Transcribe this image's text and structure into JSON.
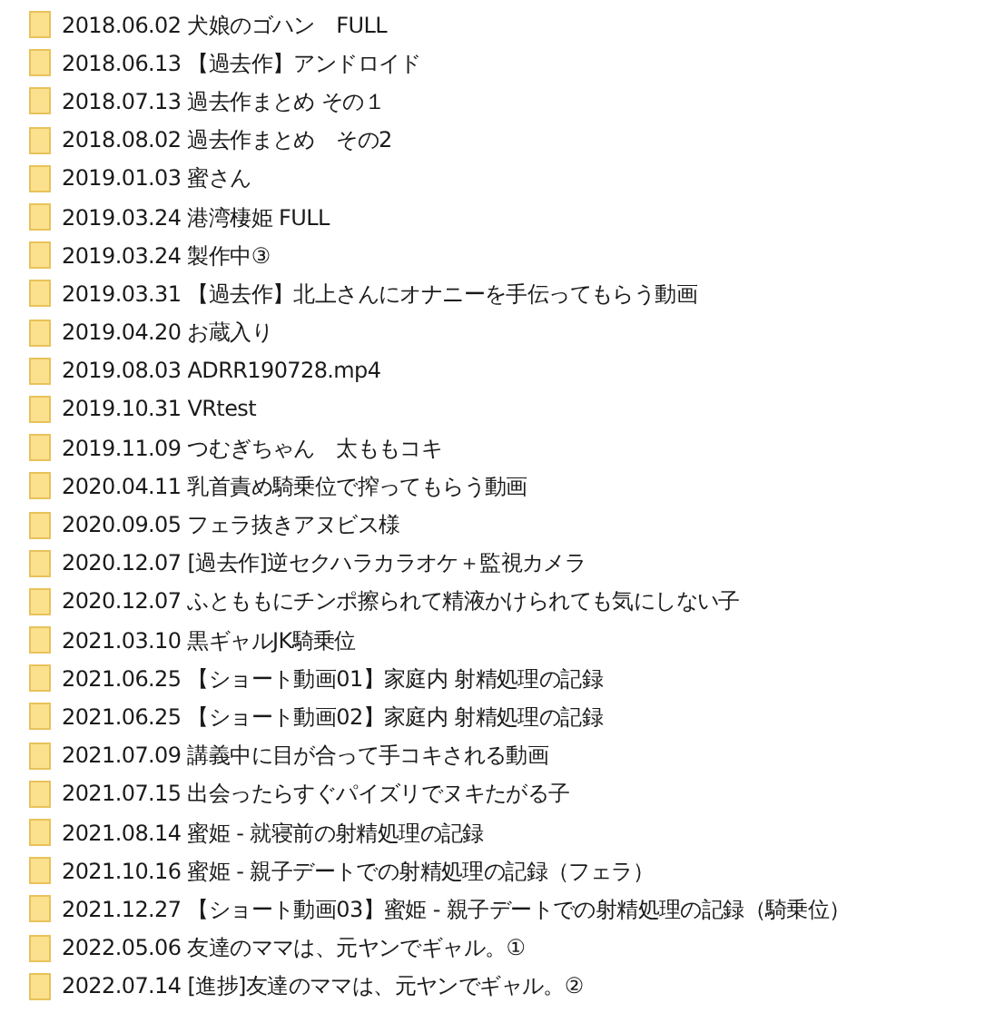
{
  "files": [
    {
      "name": "2018.06.02 犬娘のゴハン　FULL"
    },
    {
      "name": "2018.06.13 【過去作】アンドロイド"
    },
    {
      "name": "2018.07.13 過去作まとめ その１"
    },
    {
      "name": "2018.08.02 過去作まとめ　その2"
    },
    {
      "name": "2019.01.03 蜜さん"
    },
    {
      "name": "2019.03.24 港湾棲姫 FULL"
    },
    {
      "name": "2019.03.24 製作中③"
    },
    {
      "name": "2019.03.31 【過去作】北上さんにオナニーを手伝ってもらう動画"
    },
    {
      "name": "2019.04.20 お蔵入り"
    },
    {
      "name": "2019.08.03 ADRR190728.mp4"
    },
    {
      "name": "2019.10.31 VRtest"
    },
    {
      "name": "2019.11.09 つむぎちゃん　太ももコキ"
    },
    {
      "name": "2020.04.11 乳首責め騎乗位で搾ってもらう動画"
    },
    {
      "name": "2020.09.05 フェラ抜きアヌビス様"
    },
    {
      "name": "2020.12.07 [過去作]逆セクハラカラオケ＋監視カメラ"
    },
    {
      "name": "2020.12.07 ふとももにチンポ擦られて精液かけられても気にしない子"
    },
    {
      "name": "2021.03.10 黒ギャルJK騎乗位"
    },
    {
      "name": "2021.06.25 【ショート動画01】家庭内 射精処理の記録"
    },
    {
      "name": "2021.06.25 【ショート動画02】家庭内 射精処理の記録"
    },
    {
      "name": "2021.07.09 講義中に目が合って手コキされる動画"
    },
    {
      "name": "2021.07.15 出会ったらすぐパイズリでヌキたがる子"
    },
    {
      "name": "2021.08.14 蜜姫 - 就寝前の射精処理の記録"
    },
    {
      "name": "2021.10.16 蜜姫 - 親子デートでの射精処理の記録（フェラ）"
    },
    {
      "name": "2021.12.27 【ショート動画03】蜜姫 - 親子デートでの射精処理の記録（騎乗位）"
    },
    {
      "name": "2022.05.06 友達のママは、元ヤンでギャル。①"
    },
    {
      "name": "2022.07.14 [進捗]友達のママは、元ヤンでギャル。②"
    }
  ]
}
